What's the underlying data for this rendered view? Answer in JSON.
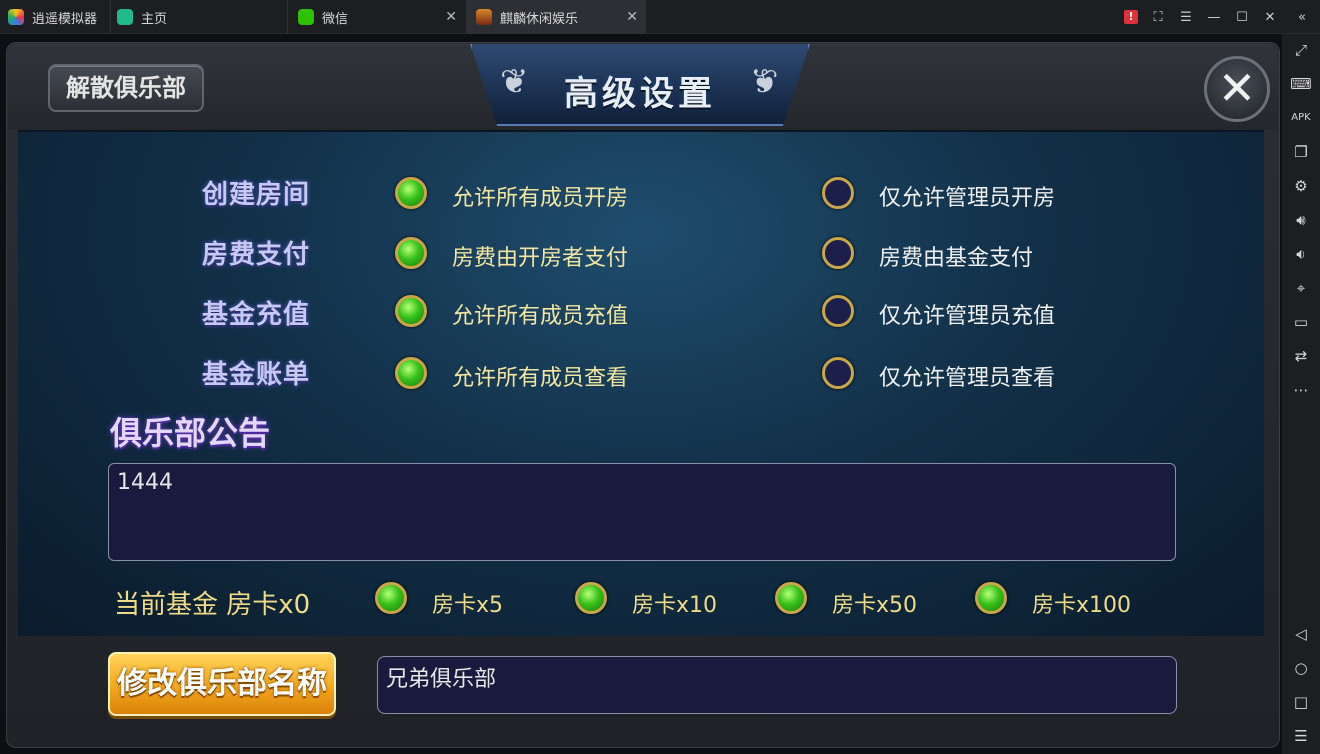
{
  "emulator": {
    "tabs": [
      {
        "label": "逍遥模拟器"
      },
      {
        "label": "主页"
      },
      {
        "label": "微信"
      },
      {
        "label": "麒麟休闲娱乐"
      }
    ],
    "alert_glyph": "!",
    "colors": {
      "tabbar": "#1d1e22",
      "active_tab": "#2e2f35",
      "alert": "#e0313a"
    },
    "sidebar_icons": [
      "collapse-icon",
      "fullscreen-icon",
      "keyboard-icon",
      "apk-icon",
      "multi-window-icon",
      "settings-icon",
      "volume-up-icon",
      "volume-down-icon",
      "location-icon",
      "folder-icon",
      "sync-icon",
      "more-icon",
      "back-icon",
      "home-icon",
      "recent-apps-icon",
      "menu-icon"
    ]
  },
  "dialog": {
    "title": "高级设置",
    "disband_label": "解散俱乐部",
    "close_glyph": "✕",
    "settings": [
      {
        "label": "创建房间",
        "option_a": "允许所有成员开房",
        "option_b": "仅允许管理员开房",
        "selected": "a"
      },
      {
        "label": "房费支付",
        "option_a": "房费由开房者支付",
        "option_b": "房费由基金支付",
        "selected": "a"
      },
      {
        "label": "基金充值",
        "option_a": "允许所有成员充值",
        "option_b": "仅允许管理员充值",
        "selected": "a"
      },
      {
        "label": "基金账单",
        "option_a": "允许所有成员查看",
        "option_b": "仅允许管理员查看",
        "selected": "a"
      }
    ],
    "notice_title": "俱乐部公告",
    "notice_text": "1444",
    "fund_label": "当前基金 房卡x0",
    "card_options": [
      "房卡x5",
      "房卡x10",
      "房卡x50",
      "房卡x100"
    ],
    "rename_label": "修改俱乐部名称",
    "club_name": "兄弟俱乐部",
    "colors": {
      "accent_gold": "#f0dc86",
      "radio_on": "#37c21a",
      "radio_off": "#1c1f4a",
      "button_orange": "#f4a81e"
    }
  }
}
